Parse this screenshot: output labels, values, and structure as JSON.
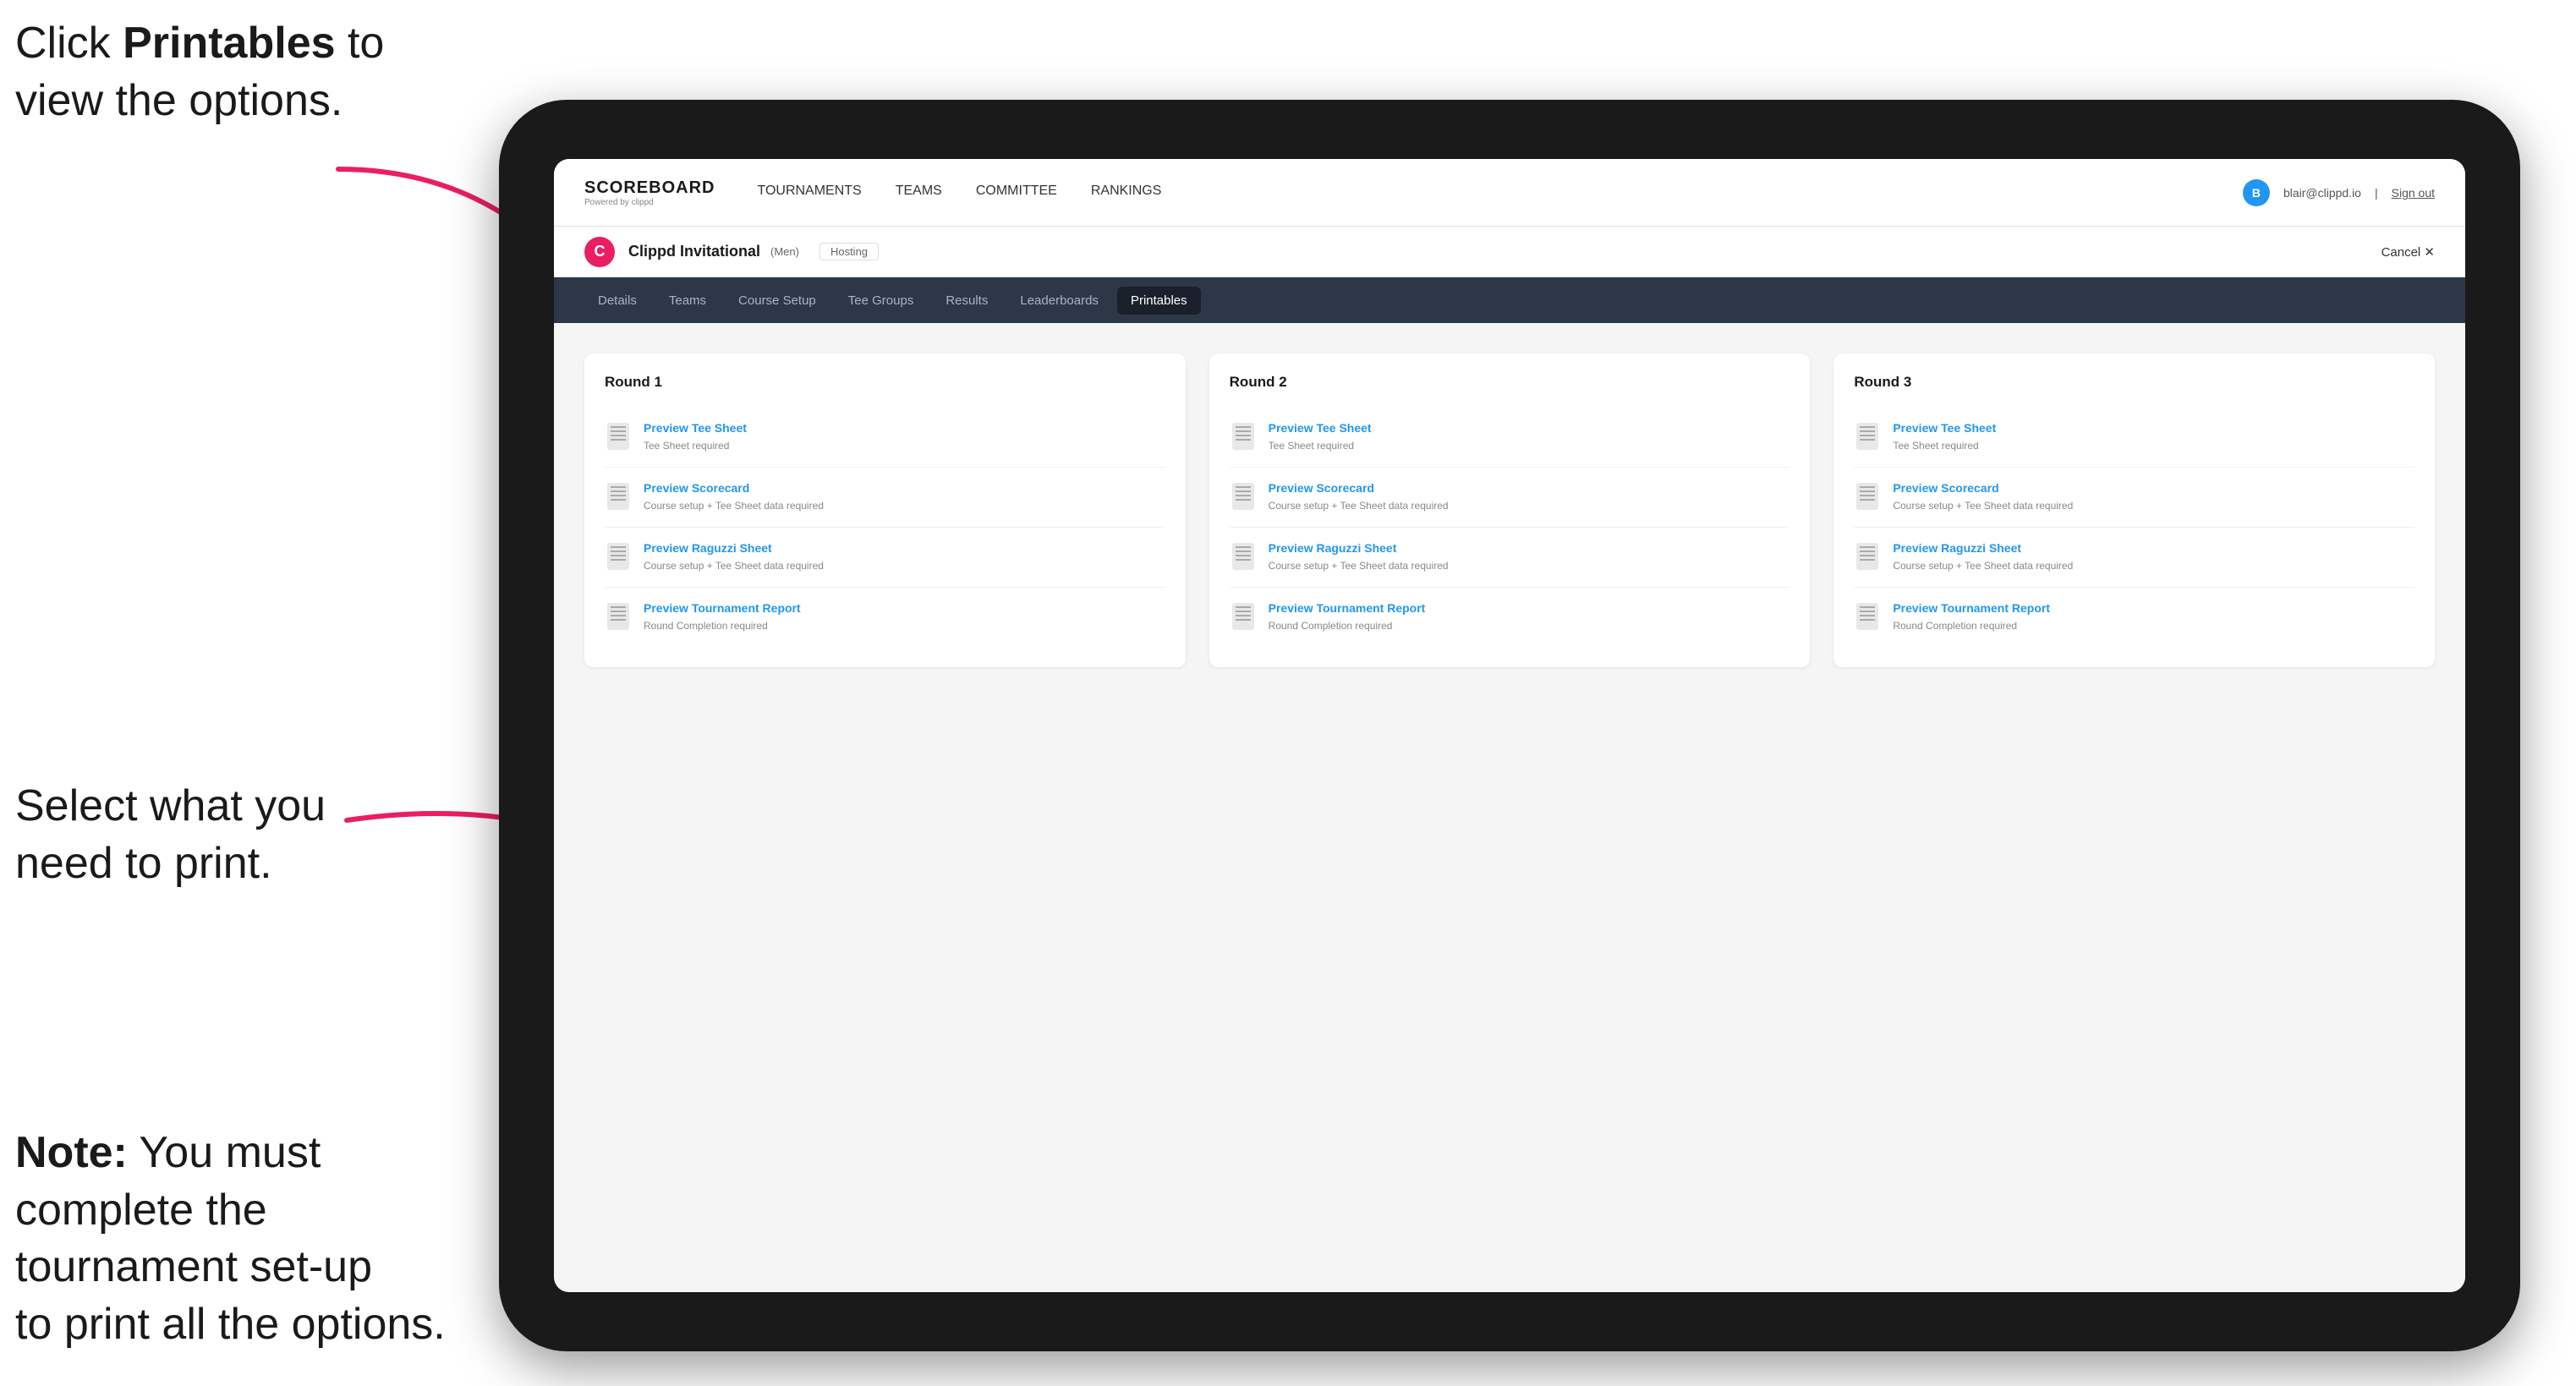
{
  "annotations": {
    "top": {
      "line1_prefix": "Click ",
      "line1_bold": "Printables",
      "line1_suffix": " to",
      "line2": "view the options."
    },
    "middle": {
      "line1": "Select what you",
      "line2": "need to print."
    },
    "bottom": {
      "line1_bold": "Note:",
      "line1_suffix": " You must",
      "line2": "complete the",
      "line3": "tournament set-up",
      "line4": "to print all the options."
    }
  },
  "top_nav": {
    "logo_title": "SCOREBOARD",
    "logo_subtitle": "Powered by clippd",
    "links": [
      {
        "label": "TOURNAMENTS",
        "active": false
      },
      {
        "label": "TEAMS",
        "active": false
      },
      {
        "label": "COMMITTEE",
        "active": false
      },
      {
        "label": "RANKINGS",
        "active": false
      }
    ],
    "user_email": "blair@clippd.io",
    "sign_out": "Sign out",
    "user_initial": "B"
  },
  "tournament_bar": {
    "logo_letter": "C",
    "name": "Clippd Invitational",
    "badge": "(Men)",
    "hosting": "Hosting",
    "cancel": "Cancel ✕"
  },
  "sub_nav": {
    "items": [
      {
        "label": "Details",
        "active": false
      },
      {
        "label": "Teams",
        "active": false
      },
      {
        "label": "Course Setup",
        "active": false
      },
      {
        "label": "Tee Groups",
        "active": false
      },
      {
        "label": "Results",
        "active": false
      },
      {
        "label": "Leaderboards",
        "active": false
      },
      {
        "label": "Printables",
        "active": true
      }
    ]
  },
  "rounds": [
    {
      "title": "Round 1",
      "items": [
        {
          "title": "Preview Tee Sheet",
          "subtitle": "Tee Sheet required"
        },
        {
          "title": "Preview Scorecard",
          "subtitle": "Course setup + Tee Sheet data required"
        },
        {
          "title": "Preview Raguzzi Sheet",
          "subtitle": "Course setup + Tee Sheet data required"
        },
        {
          "title": "Preview Tournament Report",
          "subtitle": "Round Completion required"
        }
      ]
    },
    {
      "title": "Round 2",
      "items": [
        {
          "title": "Preview Tee Sheet",
          "subtitle": "Tee Sheet required"
        },
        {
          "title": "Preview Scorecard",
          "subtitle": "Course setup + Tee Sheet data required"
        },
        {
          "title": "Preview Raguzzi Sheet",
          "subtitle": "Course setup + Tee Sheet data required"
        },
        {
          "title": "Preview Tournament Report",
          "subtitle": "Round Completion required"
        }
      ]
    },
    {
      "title": "Round 3",
      "items": [
        {
          "title": "Preview Tee Sheet",
          "subtitle": "Tee Sheet required"
        },
        {
          "title": "Preview Scorecard",
          "subtitle": "Course setup + Tee Sheet data required"
        },
        {
          "title": "Preview Raguzzi Sheet",
          "subtitle": "Course setup + Tee Sheet data required"
        },
        {
          "title": "Preview Tournament Report",
          "subtitle": "Round Completion required"
        }
      ]
    }
  ]
}
